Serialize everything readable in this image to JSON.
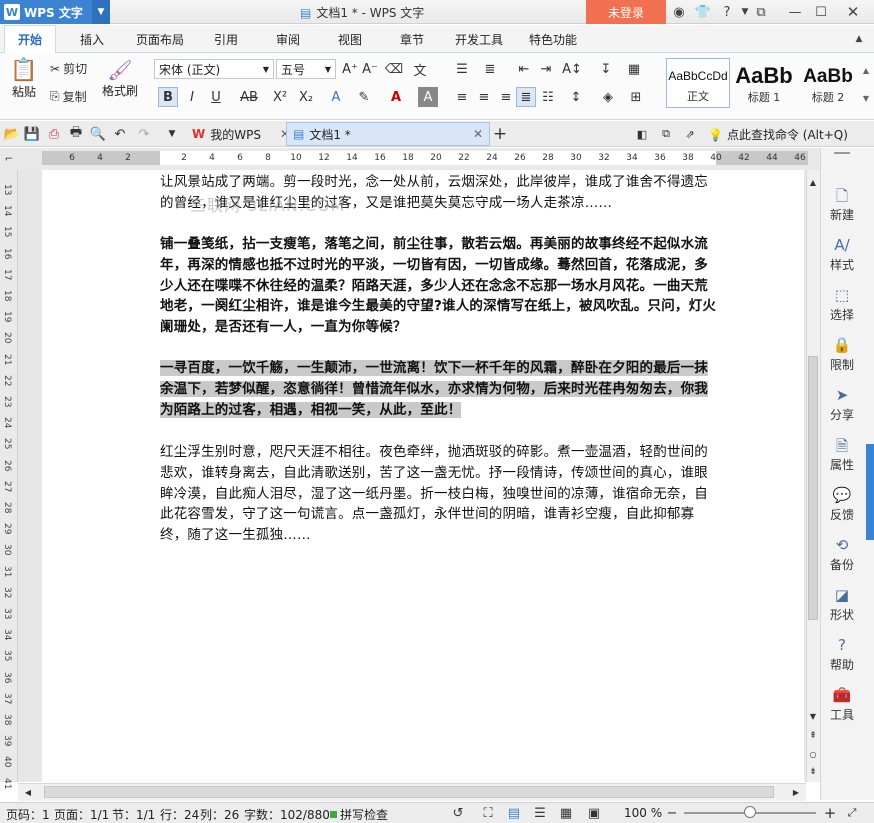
{
  "title_bar": {
    "app_name": "WPS 文字",
    "doc_title": "文档1 * - WPS 文字",
    "login": "未登录"
  },
  "menu": {
    "tabs": [
      "开始",
      "插入",
      "页面布局",
      "引用",
      "审阅",
      "视图",
      "章节",
      "开发工具",
      "特色功能"
    ]
  },
  "ribbon": {
    "paste": "粘贴",
    "cut": "剪切",
    "copy": "复制",
    "format_painter": "格式刷",
    "font_name": "宋体 (正文)",
    "font_size": "五号",
    "styles": [
      {
        "preview": "AaBbCcDd",
        "label": "正文"
      },
      {
        "preview": "AaBb",
        "label": "标题 1"
      },
      {
        "preview": "AaBb",
        "label": "标题 2"
      }
    ]
  },
  "quick_access": {
    "tabs": [
      "我的WPS",
      "文档1 *"
    ],
    "search": "点此查找命令 (Alt+Q)"
  },
  "ruler": {
    "h_ticks": [
      "6",
      "4",
      "2",
      "2",
      "4",
      "6",
      "8",
      "10",
      "12",
      "14",
      "16",
      "18",
      "20",
      "22",
      "24",
      "26",
      "28",
      "30",
      "32",
      "34",
      "36",
      "38",
      "40",
      "42",
      "44",
      "46"
    ],
    "v_ticks": [
      "13",
      "14",
      "15",
      "16",
      "17",
      "18",
      "19",
      "20",
      "21",
      "22",
      "23",
      "24",
      "25",
      "26",
      "27",
      "28",
      "29",
      "30",
      "31",
      "32",
      "33",
      "34",
      "35",
      "36",
      "37",
      "38",
      "39",
      "40",
      "41"
    ]
  },
  "document": {
    "watermark": "三联网 3LIAN.COM",
    "para1": "让风景站成了两端。剪一段时光，念一处从前，云烟深处，此岸彼岸，谁成了谁舍不得遗忘的曾经，谁又是谁红尘里的过客，又是谁把莫失莫忘守成一场人走茶凉……",
    "para2": "铺一叠笺纸，拈一支瘦笔，落笔之间，前尘往事，散若云烟。再美丽的故事终经不起似水流年，再深的情感也抵不过时光的平淡，一切皆有因，一切皆成缘。蓦然回首，花落成泥，多少人还在喋喋不休往经的温柔？陌路天涯，多少人还在念念不忘那一场水月风花。一曲天荒地老，一阕红尘相许，谁是谁今生最美的守望?谁人的深情写在纸上，被风吹乱。只问，灯火阑珊处，是否还有一人，一直为你等候？",
    "para3": "一寻百度，一饮千觞，一生颠沛，一世流离！饮下一杯千年的风霜，醉卧在夕阳的最后一抹余温下，若梦似醒，恣意徜徉！曾惜流年似水，亦求情为何物，后来时光荏冉匆匆去，你我为陌路上的过客，相遇，相视一笑，从此，至此！",
    "para4": "红尘浮生别时意，咫尺天涯不相往。夜色牵绊，抛洒斑驳的碎影。煮一壶温酒，轻酌世间的悲欢，谁转身离去，自此清歌送别，苦了这一盏无忧。抒一段情诗，传颂世间的真心，谁眼眸冷漠，自此痴人泪尽，湿了这一纸丹墨。折一枝白梅，独嗅世间的凉薄，谁宿命无奈，自此花容雪发，守了这一句谎言。点一盏孤灯，永伴世间的阴暗，谁青衫空瘦，自此抑郁寡终，随了这一生孤独……"
  },
  "side_panel": [
    "新建",
    "样式",
    "选择",
    "限制",
    "分享",
    "属性",
    "反馈",
    "备份",
    "形状",
    "帮助",
    "工具"
  ],
  "status": {
    "page_code": "页码：1",
    "page": "页面：1/1",
    "section": "节：1/1",
    "row": "行：24",
    "col": "列：26",
    "word_count": "字数：102/880",
    "spell": "拼写检查",
    "zoom": "100 %"
  },
  "colors": {
    "accent": "#3c84d2",
    "login": "#f07050",
    "highlight": "#c9c9c9"
  }
}
